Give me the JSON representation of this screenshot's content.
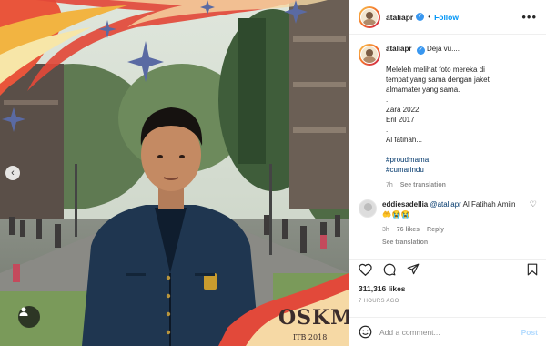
{
  "post": {
    "username": "ataliapr",
    "follow_label": "Follow",
    "more_label": "•••",
    "caption_lines": [
      "Deja vu....",
      "",
      "Meleleh melihat foto mereka di",
      "tempat yang sama dengan jaket",
      "almamater yang sama.",
      ".",
      "Zara 2022",
      "Eril 2017",
      ".",
      "Al fatihah...",
      "",
      "#proudmama",
      "#cumarindu"
    ],
    "caption_time": "7h",
    "see_translation": "See translation"
  },
  "reply": {
    "username": "eddiesadellia",
    "mention": "@ataliapr",
    "text": "Al Fatihah Amiin",
    "emoji": "🤲😭😭",
    "time": "3h",
    "likes": "76 likes",
    "reply_label": "Reply",
    "see_translation": "See translation"
  },
  "stats": {
    "likes": "311,316 likes",
    "time_ago": "7 HOURS AGO"
  },
  "composer": {
    "placeholder": "Add a comment...",
    "post_label": "Post"
  },
  "photo": {
    "overlay_title": "OSKM",
    "overlay_sub": "ITB 2018",
    "prev_label": "‹"
  },
  "colors": {
    "link_blue": "#0095f6",
    "hashtag_blue": "#00376b",
    "muted": "#8e8e8e"
  }
}
